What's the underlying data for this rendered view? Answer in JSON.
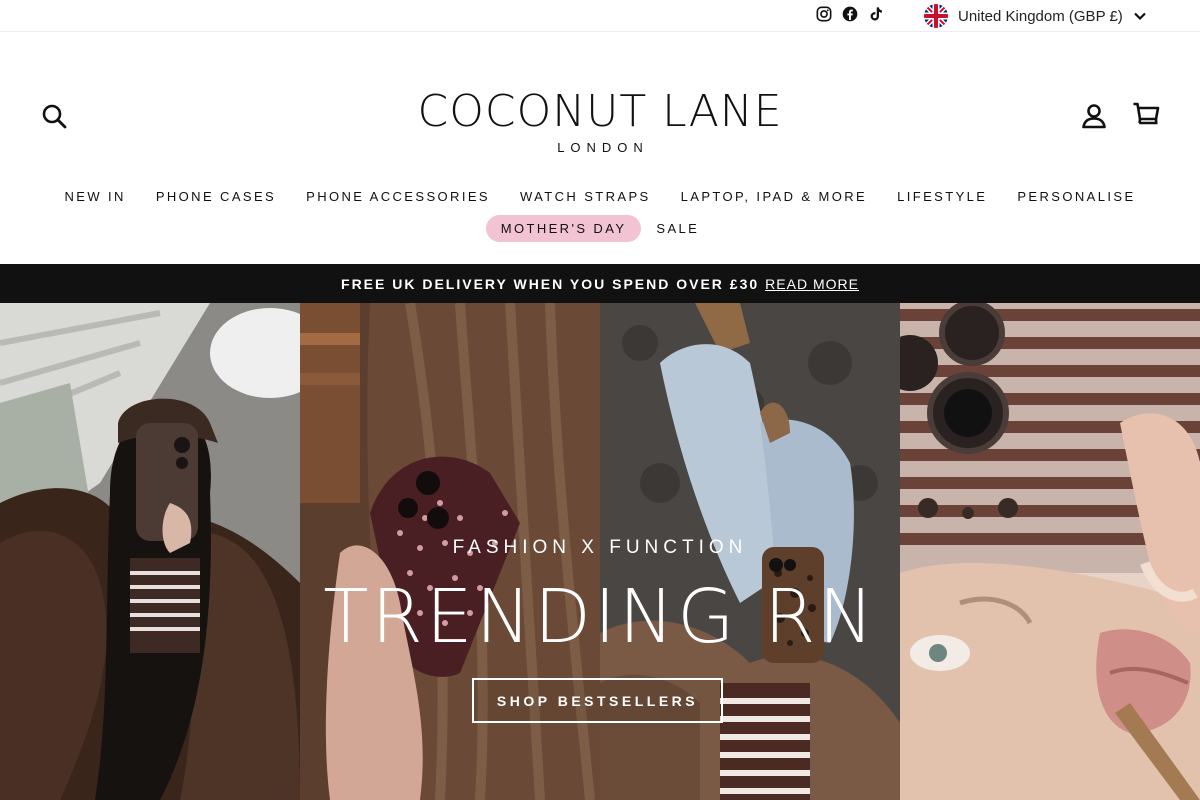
{
  "utility_bar": {
    "socials": [
      {
        "icon": "instagram-icon"
      },
      {
        "icon": "facebook-icon"
      },
      {
        "icon": "tiktok-icon"
      }
    ],
    "currency_selector": {
      "flag_icon": "uk-flag-icon",
      "label": "United Kingdom (GBP £)"
    }
  },
  "header": {
    "logo_main": "COCONUT LANE",
    "logo_sub": "LONDON",
    "icons": {
      "search": "search-icon",
      "account": "account-icon",
      "cart": "cart-icon"
    }
  },
  "nav": {
    "row1": [
      "NEW IN",
      "PHONE CASES",
      "PHONE ACCESSORIES",
      "WATCH STRAPS",
      "LAPTOP, IPAD & MORE",
      "LIFESTYLE",
      "PERSONALISE"
    ],
    "row2": [
      "MOTHER'S DAY",
      "SALE"
    ],
    "highlight_color": "#f2c3d2"
  },
  "announcement": {
    "text": "FREE UK DELIVERY WHEN YOU SPEND OVER £30",
    "link": "READ MORE",
    "background": "#111111"
  },
  "hero": {
    "kicker": "FASHION X FUNCTION",
    "headline": "TRENDING RN",
    "cta": "SHOP BESTSELLERS"
  }
}
